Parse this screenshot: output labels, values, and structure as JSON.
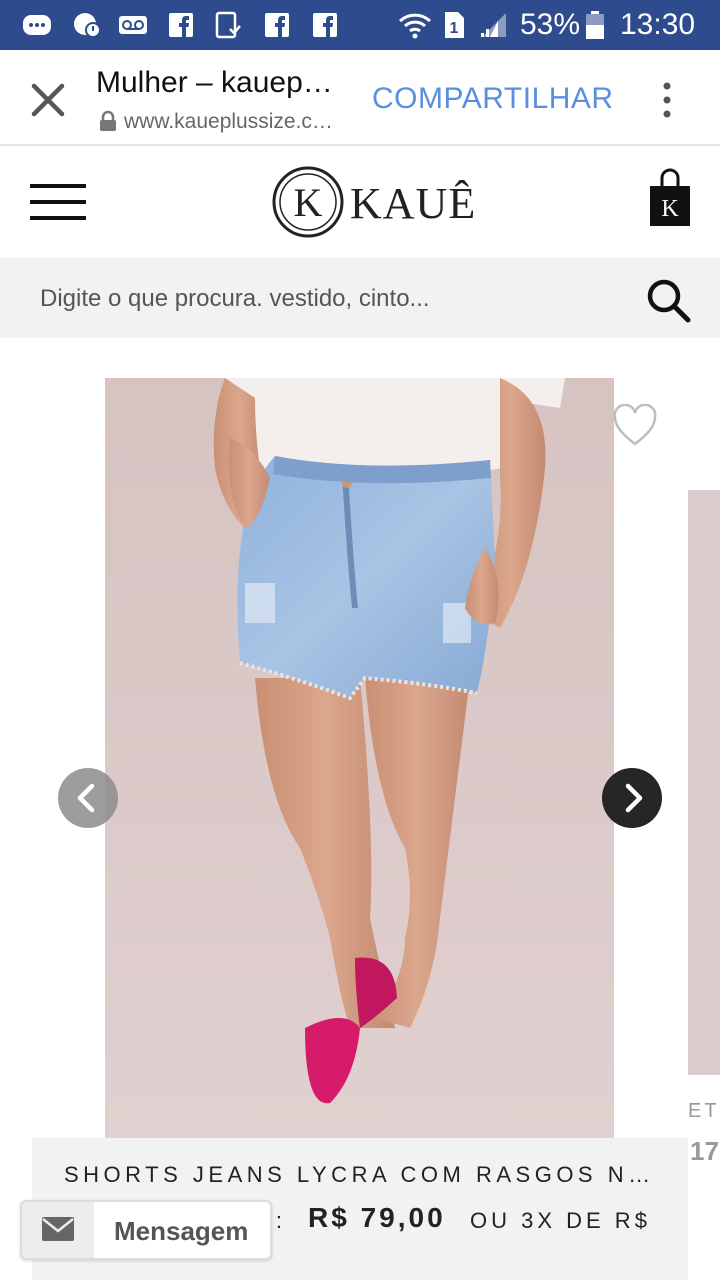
{
  "status_bar": {
    "battery": "53%",
    "time": "13:30",
    "sim": "1",
    "icons": [
      "messenger-icon",
      "facebook-messenger-icon",
      "voicemail-icon",
      "facebook-icon",
      "download-icon",
      "facebook-icon",
      "facebook-icon",
      "wifi-icon",
      "sim-icon",
      "signal-icon",
      "battery-icon"
    ]
  },
  "browser": {
    "title": "Mulher – kauep…",
    "url": "www.kaueplussize.c…",
    "share_label": "COMPARTILHAR"
  },
  "site": {
    "brand": "KAUÊ",
    "logo_letter": "K",
    "cart_letter": "K"
  },
  "search": {
    "placeholder": "Digite o que procura. vestido, cinto..."
  },
  "product": {
    "name": "SHORTS JEANS LYCRA COM RASGOS NA B…",
    "price_prefix": "R:",
    "price": "R$ 79,00",
    "installments": "OU 3X DE R$"
  },
  "next_product": {
    "name_fragment": "ET",
    "price_fragment": "17"
  },
  "message_button": {
    "label": "Mensagem"
  },
  "colors": {
    "status_bar": "#2d4b8d",
    "share_link": "#5a8fe0",
    "photo_background": "#d8c7c6",
    "panel_background": "#f2f2f2"
  }
}
